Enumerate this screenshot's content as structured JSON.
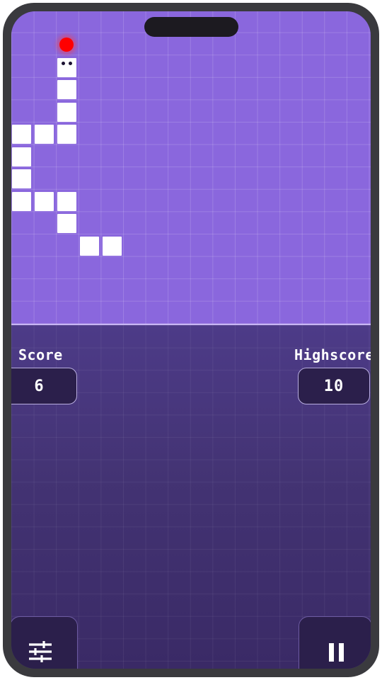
{
  "score": {
    "label": "Score",
    "value": "6"
  },
  "highscore": {
    "label": "Highscore",
    "value": "10"
  },
  "controls": {
    "settings_icon": "sliders-icon",
    "pause_icon": "pause-icon"
  },
  "colors": {
    "board": "#8a67dd",
    "panel": "#4a3a85",
    "snake": "#ffffff",
    "food": "#ff0000",
    "stat_box": "#2b1f4b"
  }
}
